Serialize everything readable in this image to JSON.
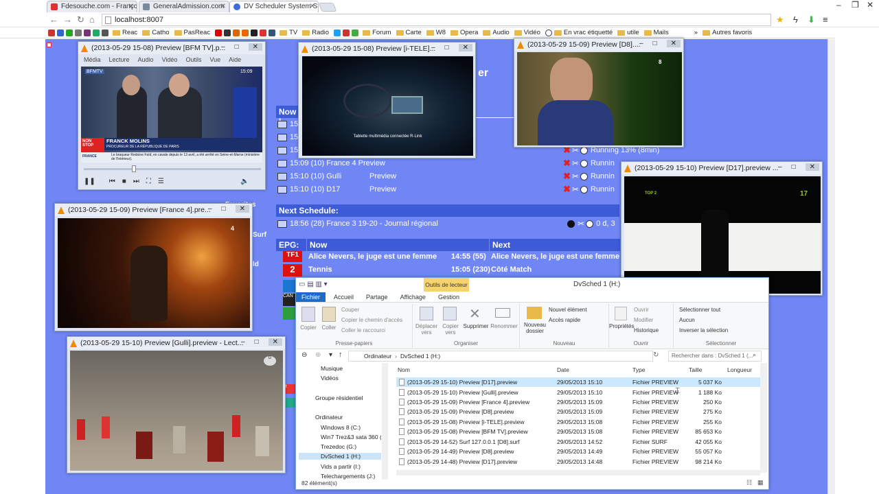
{
  "browser": {
    "tabs": [
      {
        "label": "Fdesouche.com - Françoi",
        "color": "#e03030"
      },
      {
        "label": "GeneralAdmission.com",
        "color": "#7a8a9a"
      },
      {
        "label": "DV Scheduler System Stati",
        "color": "#3b6fd8"
      }
    ],
    "url": "localhost:8007",
    "bookmarks": [
      "Reac",
      "Catho",
      "PasReac",
      "TV",
      "Radio",
      "Forum",
      "Carte",
      "W8",
      "Opera",
      "Audio",
      "Vidéo",
      "En vrac étiquetté",
      "utile",
      "Mails"
    ],
    "bookmarks_more": "»",
    "other_bookmarks": "Autres favoris"
  },
  "page": {
    "heading_fragment": "er",
    "now_label": "Now I",
    "now_rows": [
      {
        "time": "15",
        "status": ""
      },
      {
        "time": "15",
        "status": ""
      },
      {
        "time": "15",
        "status": "Running 13% (8min)"
      },
      {
        "time": "15:09 (10) France 4 Preview",
        "status": "Runnin"
      },
      {
        "time": "15:10 (10) Gulli",
        "name": "Preview",
        "status": "Runnin"
      },
      {
        "time": "15:10 (10) D17",
        "name": "Preview",
        "status": "Runnin"
      }
    ],
    "next_label": "Next Schedule:",
    "next_row": {
      "text": "18:56 (28) France 3 19-20 - Journal régional",
      "status": "0 d, 3"
    },
    "epg": {
      "label": "EPG:",
      "now_col": "Now",
      "next_col": "Next",
      "rows": [
        {
          "now": "Alice Nevers, le juge est une femme",
          "time": "14:55 (55)",
          "next": "Alice Nevers, le juge est une femme"
        },
        {
          "now": "Tennis",
          "time": "15:05 (230)",
          "next": "Côté Match"
        }
      ]
    },
    "side_fragments": [
      "Favorites",
      "Surf",
      "ld"
    ]
  },
  "vlc_windows": [
    {
      "title": "(2013-05-29 15-08) Preview [BFM TV].p...",
      "menu": [
        "Média",
        "Lecture",
        "Audio",
        "Vidéo",
        "Outils",
        "Vue",
        "Aide"
      ],
      "caption_name": "FRANCK MOLINS",
      "caption_role": "PROCUREUR DE LA RÉPUBLIQUE DE PARIS",
      "ticker": "Le braqueur Redoine Faïd, en cavale depuis le 13 avril, a été arrêté en Seine-et-Marne (ministère de l'Intérieur).",
      "clock": "15:09",
      "brand": "BFMTV",
      "nonstop": "NON STOP",
      "france": "FRANCE"
    },
    {
      "title": "(2013-05-29 15-08) Preview [i-TELE]...",
      "subtitle": "Tablette multimédia connectée R-Link"
    },
    {
      "title": "(2013-05-29 15-09) Preview [D8]...."
    },
    {
      "title": "(2013-05-29 15-10) Preview [D17].preview ..."
    },
    {
      "title": "(2013-05-29 15-09) Preview [France 4].pre..."
    },
    {
      "title": "(2013-05-29 15-10) Preview [Gulli].preview - Lect..."
    }
  ],
  "explorer": {
    "tool_tab": "Outils de lecteur",
    "title": "DvSched 1 (H:)",
    "tabs": [
      "Fichier",
      "Accueil",
      "Partage",
      "Affichage",
      "Gestion"
    ],
    "ribbon": {
      "presse_papiers": {
        "label": "Presse-papiers",
        "copier": "Copier",
        "coller": "Coller",
        "couper": "Couper",
        "copier_chemin": "Copier le chemin d'accès",
        "coller_raccourci": "Coller le raccourci"
      },
      "organiser": {
        "label": "Organiser",
        "deplacer": "Déplacer vers",
        "copier_vers": "Copier vers",
        "supprimer": "Supprimer",
        "renommer": "Renommer"
      },
      "nouveau": {
        "label": "Nouveau",
        "dossier": "Nouveau dossier",
        "element": "Nouvel élément",
        "acces": "Accès rapide"
      },
      "ouvrir": {
        "label": "Ouvrir",
        "proprietes": "Propriétés",
        "ouvrir": "Ouvrir",
        "modifier": "Modifier",
        "historique": "Historique"
      },
      "selectionner": {
        "label": "Sélectionner",
        "tout": "Sélectionner tout",
        "aucun": "Aucun",
        "inverser": "Inverser la sélection"
      }
    },
    "path": [
      "Ordinateur",
      "DvSched 1 (H:)"
    ],
    "search_placeholder": "Rechercher dans : DvSched 1 (...",
    "nav": [
      "Musique",
      "Vidéos",
      "Groupe résidentiel",
      "Ordinateur",
      "Windows 8 (C:)",
      "Win7 Trez&3 sata 360 (D",
      "Trezedoc (G:)",
      "DvSched 1 (H:)",
      "Vids a partir (I:)",
      "Telechargements (J:)"
    ],
    "columns": [
      "Nom",
      "Date",
      "Type",
      "Taille",
      "Longueur"
    ],
    "files": [
      {
        "name": "(2013-05-29 15-10) Preview [D17].preview",
        "date": "29/05/2013 15:10",
        "type": "Fichier PREVIEW",
        "size": "5 037 Ko"
      },
      {
        "name": "(2013-05-29 15-10) Preview [Gulli].preview",
        "date": "29/05/2013 15:10",
        "type": "Fichier PREVIEW",
        "size": "1 188 Ko"
      },
      {
        "name": "(2013-05-29 15-09) Preview [France 4].preview",
        "date": "29/05/2013 15:09",
        "type": "Fichier PREVIEW",
        "size": "250 Ko"
      },
      {
        "name": "(2013-05-29 15-09) Preview [D8].preview",
        "date": "29/05/2013 15:09",
        "type": "Fichier PREVIEW",
        "size": "275 Ko"
      },
      {
        "name": "(2013-05-29 15-08) Preview [i-TELE].preview",
        "date": "29/05/2013 15:08",
        "type": "Fichier PREVIEW",
        "size": "255 Ko"
      },
      {
        "name": "(2013-05-29 15-08) Preview [BFM TV].preview",
        "date": "29/05/2013 15:08",
        "type": "Fichier PREVIEW",
        "size": "85 653 Ko"
      },
      {
        "name": "(2013-05-29 14-52) Surf 127.0.0.1 [D8].surf",
        "date": "29/05/2013 14:52",
        "type": "Fichier SURF",
        "size": "42 055 Ko"
      },
      {
        "name": "(2013-05-29 14-49) Preview [D8].preview",
        "date": "29/05/2013 14:49",
        "type": "Fichier PREVIEW",
        "size": "55 057 Ko"
      },
      {
        "name": "(2013-05-29 14-48) Preview [D17].preview",
        "date": "29/05/2013 14:48",
        "type": "Fichier PREVIEW",
        "size": "98 214 Ko"
      }
    ],
    "status": "82 élément(s)"
  }
}
